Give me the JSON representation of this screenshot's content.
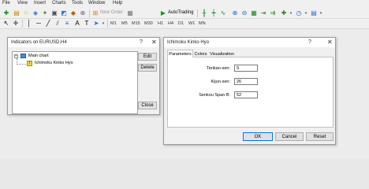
{
  "menu": [
    "File",
    "View",
    "Insert",
    "Charts",
    "Tools",
    "Window",
    "Help"
  ],
  "toolbar": {
    "new_order": "New Order",
    "autotrading": "AutoTrading",
    "periods": [
      "M1",
      "M5",
      "M15",
      "M30",
      "H1",
      "H4",
      "D1",
      "W1",
      "MN"
    ]
  },
  "indicators_dialog": {
    "title": "Indicators on EURUSD,H4",
    "help": "?",
    "close_x": "✕",
    "tree_root": "Main chart",
    "tree_child": "Ichimoku Kinko Hyo",
    "edit": "Edit",
    "delete": "Delete",
    "close": "Close"
  },
  "ichimoku_dialog": {
    "title": "Ichimoku Kinko Hyo",
    "help": "?",
    "close_x": "✕",
    "tabs": [
      "Parameters",
      "Colors",
      "Visualization"
    ],
    "fields": [
      {
        "label": "Tenkan-sen:",
        "value": "9"
      },
      {
        "label": "Kijun-sen:",
        "value": "26"
      },
      {
        "label": "Senkou Span B:",
        "value": "52"
      }
    ],
    "ok": "OK",
    "cancel": "Cancel",
    "reset": "Reset"
  },
  "colors": {
    "accent": "#0078d7",
    "tab_panel": "#ffffff",
    "workspace": "#ececec"
  }
}
